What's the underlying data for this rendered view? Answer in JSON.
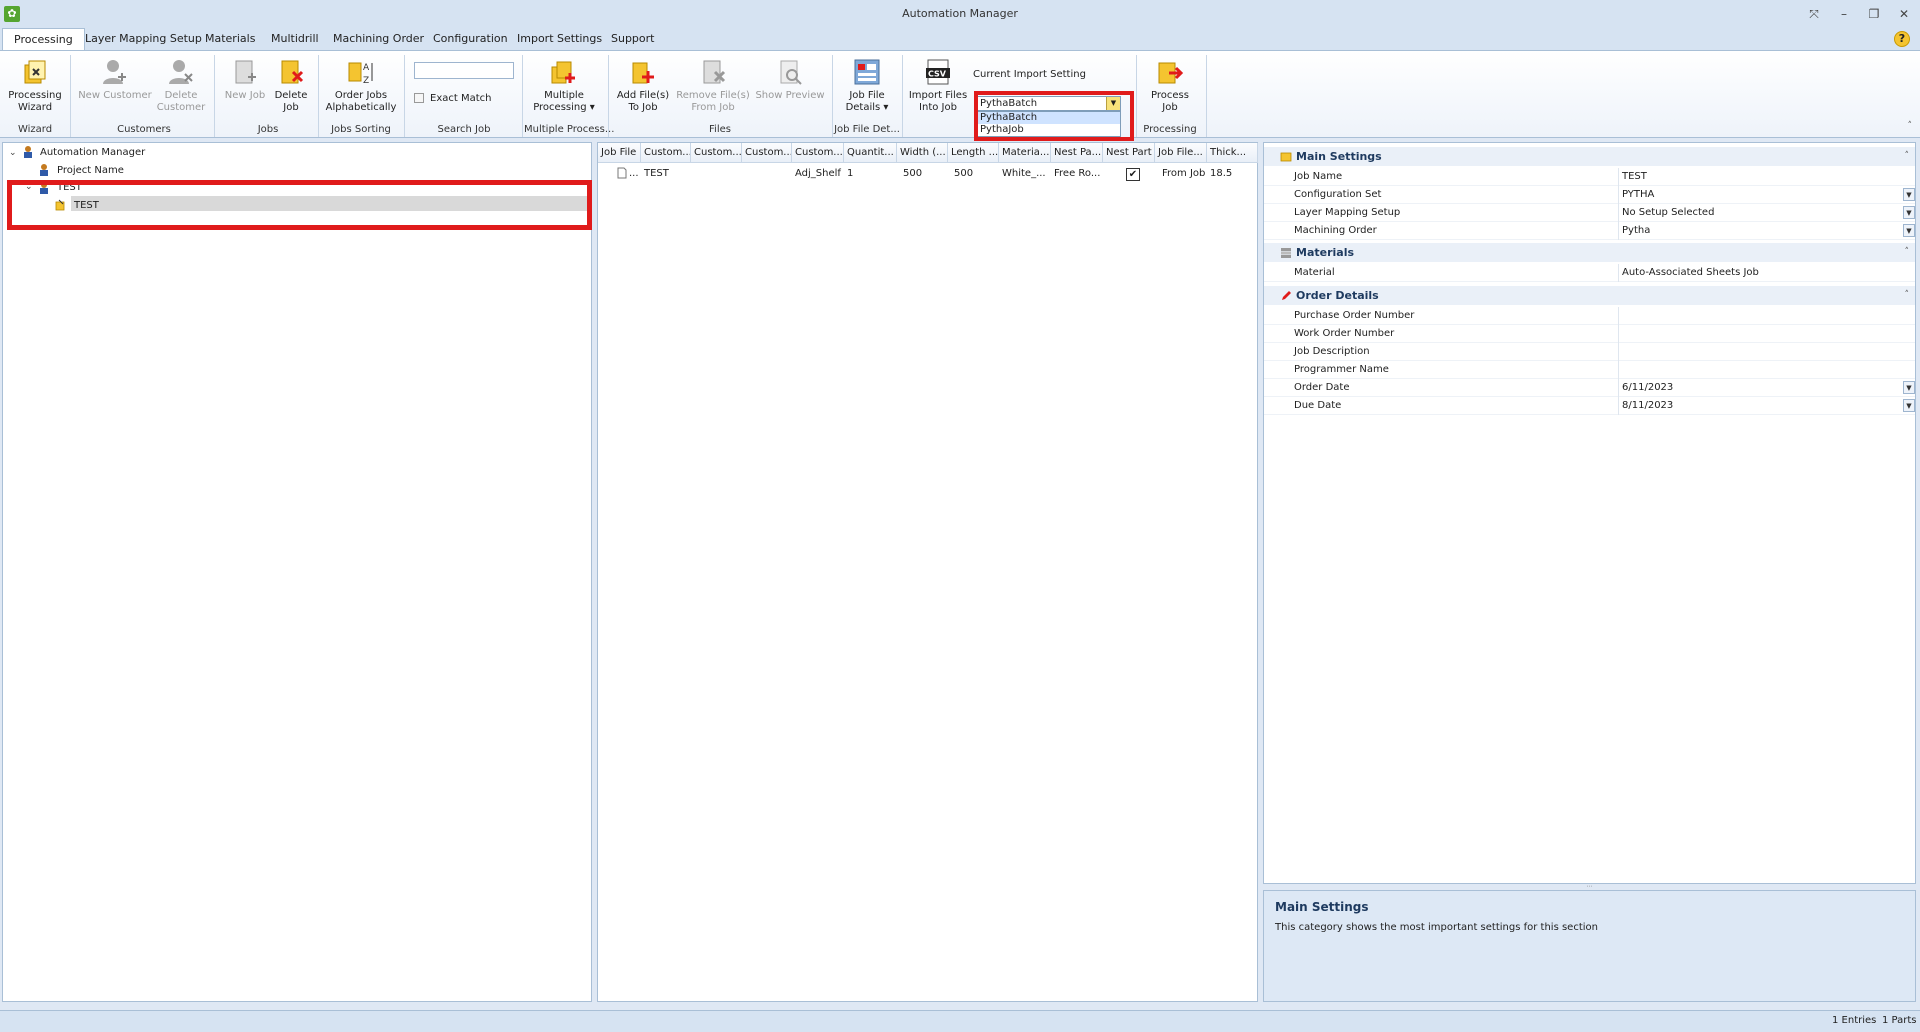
{
  "app": {
    "icon": "automation-manager-app-icon",
    "title": "Automation Manager"
  },
  "window_controls": {
    "pin": "⤧",
    "minimize": "–",
    "restore": "❐",
    "close": "✕"
  },
  "tabs": [
    "Processing",
    "Layer Mapping Setup",
    "Materials",
    "Multidrill",
    "Machining Order",
    "Configuration",
    "Import Settings",
    "Support"
  ],
  "help_label": "?",
  "ribbon": {
    "buttons": {
      "processing_wizard": "Processing\nWizard",
      "new_customer": "New Customer",
      "delete_customer": "Delete\nCustomer",
      "new_job": "New Job",
      "delete_job": "Delete\nJob",
      "order_jobs": "Order Jobs\nAlphabetically",
      "multiple_processing": "Multiple\nProcessing ▾",
      "add_files": "Add File(s)\nTo Job",
      "remove_files": "Remove File(s)\nFrom Job",
      "show_preview": "Show Preview",
      "job_file_details": "Job File\nDetails ▾",
      "import_files": "Import Files\nInto Job",
      "process_job": "Process\nJob"
    },
    "groups": {
      "wizard": "Wizard",
      "customers": "Customers",
      "jobs": "Jobs",
      "jobs_sorting": "Jobs Sorting",
      "search_job": "Search Job",
      "multiple_process": "Multiple Process...",
      "files": "Files",
      "job_file_det": "Job File Det...",
      "processing": "Processing"
    },
    "search": {
      "value": "",
      "exact_match": "Exact Match"
    },
    "import_setting": {
      "label": "Current Import Setting",
      "value": "PythaBatch",
      "options": [
        "PythaBatch",
        "PythaJob"
      ]
    },
    "collapse": "˄"
  },
  "tree": {
    "root": "Automation Manager",
    "project": "Project Name",
    "customer": "TEST",
    "job": "TEST"
  },
  "grid": {
    "columns": [
      "Job File",
      "Custom...",
      "Custom...",
      "Custom...",
      "Custom...",
      "Quantit...",
      "Width (...",
      "Length ...",
      "Materia...",
      "Nest Pa...",
      "Nest Part",
      "Job File...",
      "Thick..."
    ],
    "rows": [
      [
        "...",
        "TEST",
        "",
        "",
        "Adj_Shelf",
        "1",
        "500",
        "500",
        "White_...",
        "Free Ro...",
        "✔",
        "From Job",
        "18.5"
      ]
    ]
  },
  "properties": {
    "main_settings": {
      "title": "Main Settings",
      "rows": [
        {
          "name": "Job Name",
          "value": "TEST"
        },
        {
          "name": "Configuration Set",
          "value": "PYTHA"
        },
        {
          "name": "Layer Mapping Setup",
          "value": "No Setup Selected"
        },
        {
          "name": "Machining Order",
          "value": "Pytha"
        }
      ]
    },
    "materials": {
      "title": "Materials",
      "rows": [
        {
          "name": "Material",
          "value": "Auto-Associated Sheets Job"
        }
      ]
    },
    "order_details": {
      "title": "Order Details",
      "rows": [
        {
          "name": "Purchase Order Number",
          "value": ""
        },
        {
          "name": "Work Order Number",
          "value": ""
        },
        {
          "name": "Job Description",
          "value": ""
        },
        {
          "name": "Programmer Name",
          "value": ""
        },
        {
          "name": "Order Date",
          "value": "6/11/2023"
        },
        {
          "name": "Due Date",
          "value": "8/11/2023"
        }
      ]
    }
  },
  "description": {
    "title": "Main Settings",
    "text": "This category shows the most important settings for this section"
  },
  "status": {
    "entries": "1 Entries",
    "parts": "1 Parts"
  },
  "colors": {
    "highlight": "#e01b1b",
    "accent": "#55a530",
    "dropdown_btn": "#f7e27a"
  }
}
